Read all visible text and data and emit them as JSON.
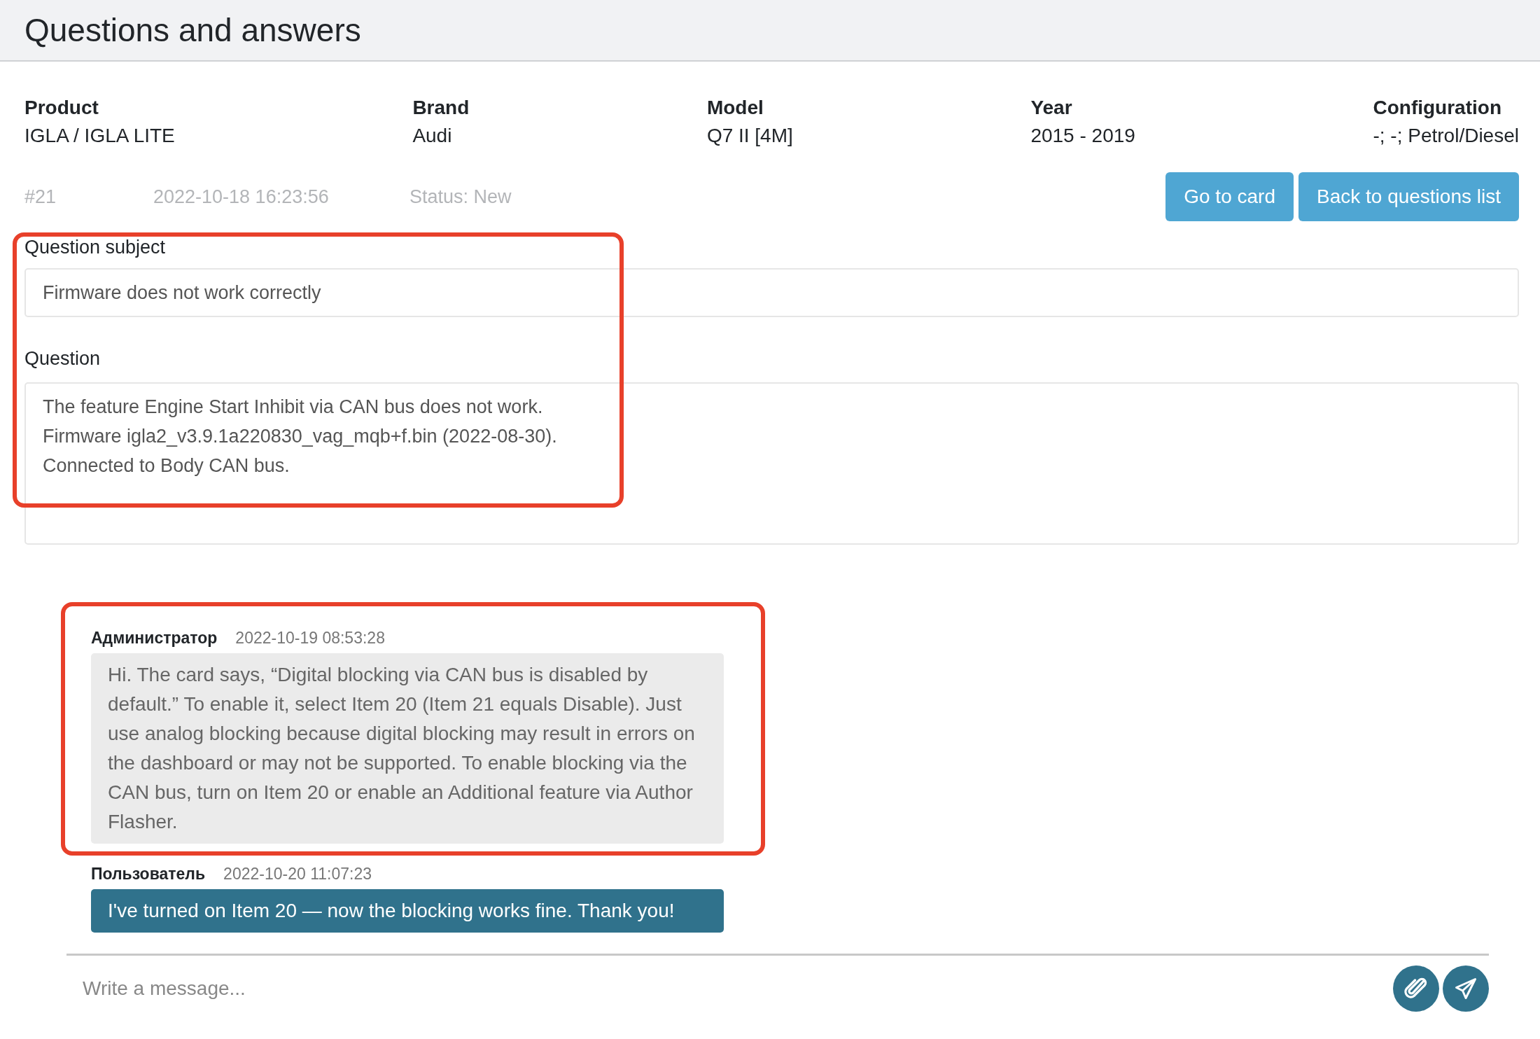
{
  "page": {
    "title": "Questions and answers"
  },
  "info": [
    {
      "label": "Product",
      "value": "IGLA / IGLA LITE"
    },
    {
      "label": "Brand",
      "value": "Audi"
    },
    {
      "label": "Model",
      "value": "Q7 II [4M]"
    },
    {
      "label": "Year",
      "value": "2015 - 2019"
    },
    {
      "label": "Configuration",
      "value": "-; -; Petrol/Diesel"
    }
  ],
  "meta": {
    "number": "#21",
    "created": "2022-10-18 16:23:56",
    "status": "Status: New"
  },
  "buttons": [
    "Go to card",
    "Back to questions list"
  ],
  "question": {
    "highlighted": true,
    "subject_label": "Question subject",
    "subject": "Firmware does not work correctly",
    "question_label": "Question",
    "text_lines": [
      "The feature Engine Start Inhibit via CAN bus does not work.",
      "Firmware igla2_v3.9.1a220830_vag_mqb+f.bin (2022-08-30).",
      "Connected to Body CAN bus."
    ]
  },
  "messages": [
    {
      "kind": "admin",
      "highlighted": true,
      "author": "Администратор",
      "time": "2022-10-19 08:53:28",
      "text": "Hi. The card says, “Digital blocking via CAN bus is disabled by default.” To enable it, select Item 20 (Item 21 equals Disable). Just use analog blocking because digital blocking may result in errors on the dashboard or may not be supported. To enable blocking via the CAN bus, turn on Item 20 or enable an Additional feature via Author Flasher."
    },
    {
      "kind": "user",
      "highlighted": false,
      "author": "Пользователь",
      "time": "2022-10-20 11:07:23",
      "text": "I've turned on Item 20 — now the blocking works fine. Thank you!"
    }
  ],
  "composer": {
    "placeholder": "Write a message..."
  }
}
